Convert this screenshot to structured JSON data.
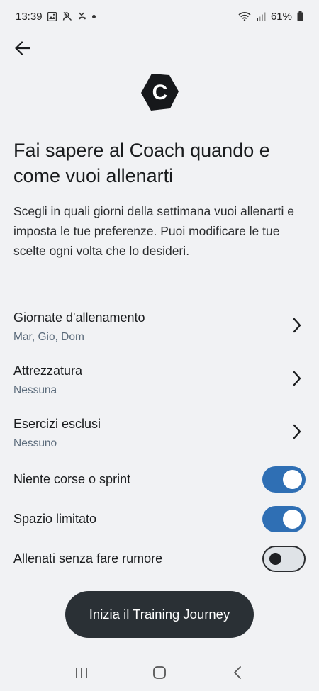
{
  "status_bar": {
    "time": "13:39",
    "battery": "61%",
    "icons_left": [
      "image-icon",
      "person-off-icon",
      "missed-call-icon",
      "dot-icon"
    ],
    "icons_right": [
      "wifi-icon",
      "signal-icon",
      "battery-icon"
    ]
  },
  "header": {
    "back_icon": "arrow-left-icon",
    "logo_letter": "C"
  },
  "main": {
    "title": "Fai sapere al Coach quando e come vuoi allenarti",
    "description": "Scegli in quali giorni della settimana vuoi allenarti e imposta le tue preferenze. Puoi modificare le tue scelte ogni volta che lo desideri."
  },
  "settings": [
    {
      "label": "Giornate d'allenamento",
      "value": "Mar, Gio, Dom"
    },
    {
      "label": "Attrezzatura",
      "value": "Nessuna"
    },
    {
      "label": "Esercizi esclusi",
      "value": "Nessuno"
    }
  ],
  "toggles": [
    {
      "label": "Niente corse o sprint",
      "state": "on"
    },
    {
      "label": "Spazio limitato",
      "state": "on"
    },
    {
      "label": "Allenati senza fare rumore",
      "state": "off"
    }
  ],
  "cta": {
    "label": "Inizia il Training Journey"
  },
  "colors": {
    "background": "#f1f2f4",
    "toggle_on": "#2f6fb4",
    "cta_bg": "#2a3035",
    "subtext": "#5a6a7a"
  },
  "nav_bar": {
    "icons": [
      "recent-apps-icon",
      "home-icon",
      "back-icon"
    ]
  }
}
